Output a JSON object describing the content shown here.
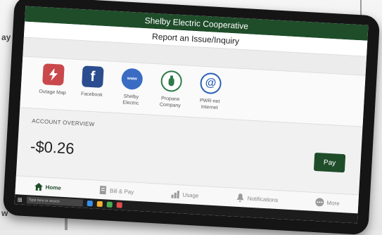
{
  "background": {
    "left_text_top": "ay",
    "left_text_bottom": "w"
  },
  "app": {
    "title": "Shelby Electric Cooperative",
    "subtitle": "Report an Issue/Inquiry"
  },
  "quick_links": [
    {
      "label": "Outage Map",
      "icon": "lightning-icon",
      "color": "#c9484b"
    },
    {
      "label": "Facebook",
      "icon": "facebook-icon",
      "color": "#2b4c8e"
    },
    {
      "label": "Shelby Electric",
      "icon": "website-icon",
      "color": "#3a6cc4"
    },
    {
      "label": "Propane Company",
      "icon": "propane-tank-icon",
      "color": "#2f7a4a"
    },
    {
      "label": "PWR-net Internet",
      "icon": "at-sign-icon",
      "color": "#2a5fb8"
    }
  ],
  "account": {
    "overview_label": "ACCOUNT OVERVIEW",
    "balance": "-$0.26",
    "pay_label": "Pay"
  },
  "tabs": [
    {
      "label": "Home",
      "active": true
    },
    {
      "label": "Bill & Pay",
      "active": false
    },
    {
      "label": "Usage",
      "active": false
    },
    {
      "label": "Notifications",
      "active": false
    },
    {
      "label": "More",
      "active": false
    }
  ],
  "taskbar": {
    "search_placeholder": "Type here to search"
  },
  "colors": {
    "brand_green": "#1f4d2a"
  }
}
